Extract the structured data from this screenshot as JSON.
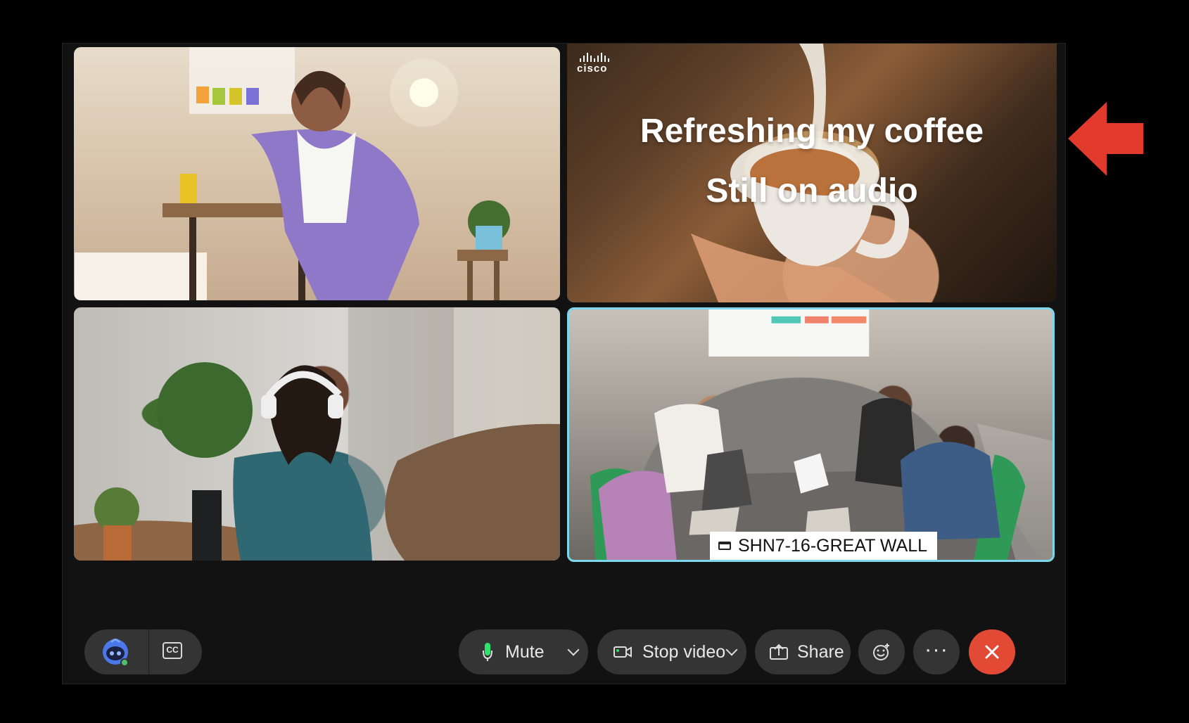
{
  "meeting": {
    "brand": "cisco",
    "status_line_1": "Refreshing my coffee",
    "status_line_2": "Still on audio",
    "room_label": "SHN7-16-GREAT WALL"
  },
  "toolbar": {
    "cc_label": "CC",
    "mute_label": "Mute",
    "stop_video_label": "Stop video",
    "share_label": "Share",
    "more_label": "···"
  },
  "colors": {
    "active_tile_border": "#7cd6ec",
    "end_call": "#e34a35",
    "annotation_arrow": "#e23b2e",
    "toolbar_pill": "#343434"
  },
  "icons": {
    "ai": "ai-assistant-icon",
    "captions": "closed-captions-icon",
    "mute": "microphone-icon",
    "video": "camera-icon",
    "share": "share-icon",
    "reaction": "reaction-icon",
    "more": "more-icon",
    "end": "close-icon"
  }
}
